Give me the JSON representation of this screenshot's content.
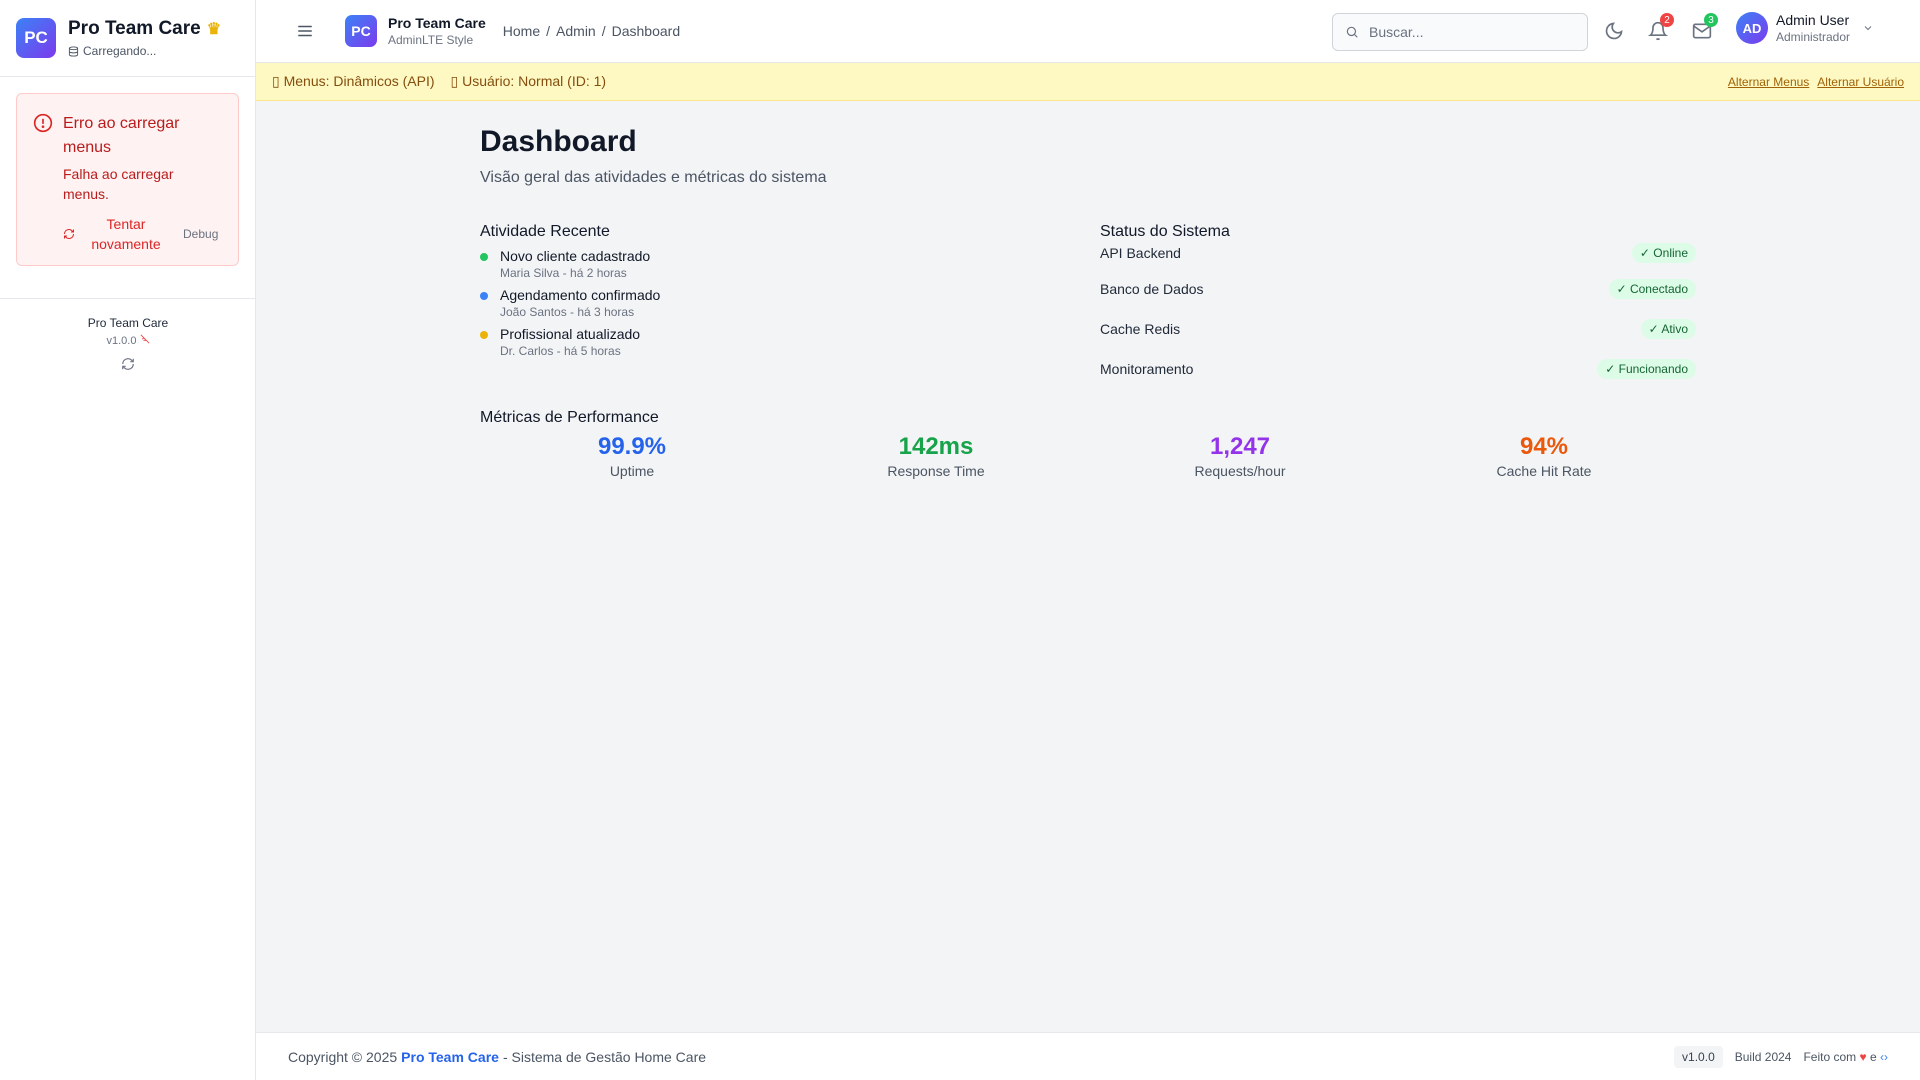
{
  "sidebar": {
    "logo_text": "PC",
    "title": "Pro Team Care",
    "status": "Carregando...",
    "error": {
      "title": "Erro ao carregar menus",
      "message": "Falha ao carregar menus.",
      "retry_label": "Tentar novamente",
      "debug_label": "Debug"
    },
    "footer": {
      "name": "Pro Team Care",
      "version": "v1.0.0"
    }
  },
  "header": {
    "logo_text": "PC",
    "brand_title": "Pro Team Care",
    "brand_subtitle": "AdminLTE Style",
    "breadcrumb": [
      "Home",
      "/",
      "Admin",
      "/",
      "Dashboard"
    ],
    "search_placeholder": "Buscar...",
    "notifications_count": "2",
    "messages_count": "3",
    "user": {
      "initials": "AD",
      "name": "Admin User",
      "role": "Administrador"
    }
  },
  "devbar": {
    "menus": "Menus: Dinâmicos (API)",
    "user": "Usuário: Normal (ID: 1)",
    "toggle_menus": "Alternar Menus",
    "toggle_user": "Alternar Usuário"
  },
  "main": {
    "title": "Dashboard",
    "subtitle": "Visão geral das atividades e métricas do sistema",
    "activity": {
      "title": "Atividade Recente",
      "items": [
        {
          "title": "Novo cliente cadastrado",
          "sub": "Maria Silva - há 2 horas",
          "color": "#22c55e"
        },
        {
          "title": "Agendamento confirmado",
          "sub": "João Santos - há 3 horas",
          "color": "#3b82f6"
        },
        {
          "title": "Profissional atualizado",
          "sub": "Dr. Carlos - há 5 horas",
          "color": "#eab308"
        }
      ]
    },
    "status": {
      "title": "Status do Sistema",
      "items": [
        {
          "label": "API Backend",
          "value": "✓ Online"
        },
        {
          "label": "Banco de Dados",
          "value": "✓ Conectado"
        },
        {
          "label": "Cache Redis",
          "value": "✓ Ativo"
        },
        {
          "label": "Monitoramento",
          "value": "✓ Funcionando"
        }
      ]
    },
    "metrics": {
      "title": "Métricas de Performance",
      "items": [
        {
          "value": "99.9%",
          "label": "Uptime",
          "color": "#2563eb"
        },
        {
          "value": "142ms",
          "label": "Response Time",
          "color": "#16a34a"
        },
        {
          "value": "1,247",
          "label": "Requests/hour",
          "color": "#9333ea"
        },
        {
          "value": "94%",
          "label": "Cache Hit Rate",
          "color": "#ea580c"
        }
      ]
    }
  },
  "footer": {
    "copyright": "Copyright © 2025",
    "brand": "Pro Team Care",
    "tagline": "- Sistema de Gestão Home Care",
    "version": "v1.0.0",
    "build": "Build 2024",
    "made_with": "Feito com",
    "and": "e"
  },
  "icons": {
    "crown": "crown-icon",
    "database": "database-icon",
    "error": "alert-circle-icon",
    "refresh": "refresh-icon",
    "menu": "hamburger-menu-icon",
    "search": "search-icon",
    "moon": "moon-icon",
    "bell": "bell-icon",
    "mail": "mail-icon",
    "chevron": "chevron-down-icon",
    "heart": "heart-icon",
    "code": "code-icon"
  }
}
